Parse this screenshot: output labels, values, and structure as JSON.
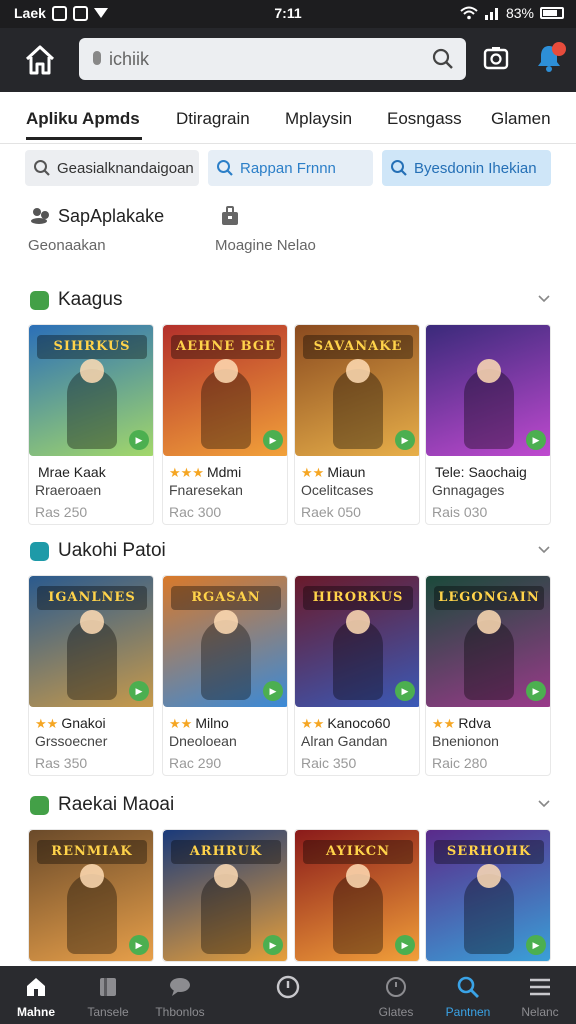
{
  "status_bar": {
    "left_text": "Laek",
    "time": "7:11",
    "battery": "83%"
  },
  "search": {
    "placeholder": "ichiik"
  },
  "tabs": [
    {
      "label": "Apliku Apmds"
    },
    {
      "label": "Dtiragrain"
    },
    {
      "label": "Mplaysin"
    },
    {
      "label": "Eosngass"
    },
    {
      "label": "Glamen"
    }
  ],
  "chips": [
    {
      "label": "Geasialknandaigoan"
    },
    {
      "label": "Rappan Frnnn"
    },
    {
      "label": "Byesdonin Ihekian"
    }
  ],
  "shortcuts": [
    {
      "title": "SapAplakake",
      "subtitle": "Geonaakan"
    },
    {
      "title": "",
      "subtitle": "Moagine Nelao"
    }
  ],
  "sections": [
    {
      "title": "Kaagus",
      "badge_color": "#43a047",
      "badge_icon": "gamepad-icon",
      "cards": [
        {
          "logo": "SIHRKUS",
          "stars": "",
          "name": "Mrae Kaak",
          "sub": "Rraeroaen",
          "price": "Ras 250",
          "colors": [
            "#2b6fb8",
            "#a3d86a"
          ]
        },
        {
          "logo": "AEHNE BGE",
          "stars": "★★★",
          "name": "Mdmi",
          "sub": "Fnaresekan",
          "price": "Rac 300",
          "colors": [
            "#b3302b",
            "#f2a23a"
          ]
        },
        {
          "logo": "SAVANAKE",
          "stars": "★★",
          "name": "Miaun",
          "sub": "Ocelitcases",
          "price": "Raek 050",
          "colors": [
            "#8a4a1f",
            "#e8b04a"
          ]
        },
        {
          "logo": "",
          "stars": "",
          "name": "Tele: Saochaig",
          "sub": "Gnnagages",
          "price": "Rais 030",
          "colors": [
            "#3a2a7a",
            "#c04ad0"
          ]
        }
      ]
    },
    {
      "title": "Uakohi Patoi",
      "badge_color": "#1e9aa8",
      "badge_icon": "star-icon",
      "cards": [
        {
          "logo": "IGANLNES",
          "stars": "★★",
          "name": "Gnakoi",
          "sub": "Grssoecner",
          "price": "Ras 350",
          "colors": [
            "#2a5a8e",
            "#c89a4a"
          ]
        },
        {
          "logo": "RGASAN",
          "stars": "★★",
          "name": "Milno",
          "sub": "Dneoloean",
          "price": "Rac 290",
          "colors": [
            "#d9792a",
            "#3a8ad8"
          ]
        },
        {
          "logo": "HIRORKUS",
          "stars": "★★",
          "name": "Kanoco60",
          "sub": "Alran Gandan",
          "price": "Raic 350",
          "colors": [
            "#6a1a2a",
            "#3a5ab8"
          ]
        },
        {
          "logo": "LEGONGAIN",
          "stars": "★★",
          "name": "Rdva",
          "sub": "Bnenionon",
          "price": "Raic 280",
          "colors": [
            "#1a4a3a",
            "#9a3a8a"
          ]
        }
      ]
    },
    {
      "title": "Raekai Maoai",
      "badge_color": "#43a047",
      "badge_icon": "gamepad-icon",
      "cards": [
        {
          "logo": "RENMIAK",
          "stars": "",
          "name": "",
          "sub": "",
          "price": "",
          "colors": [
            "#6a4a2a",
            "#e8a04a"
          ]
        },
        {
          "logo": "ARHRUK",
          "stars": "",
          "name": "",
          "sub": "",
          "price": "",
          "colors": [
            "#1a3a7a",
            "#e8a03a"
          ]
        },
        {
          "logo": "AYIKCN",
          "stars": "",
          "name": "",
          "sub": "",
          "price": "",
          "colors": [
            "#8a1a1a",
            "#f2a03a"
          ]
        },
        {
          "logo": "SERHOHK",
          "stars": "",
          "name": "",
          "sub": "",
          "price": "",
          "colors": [
            "#5a2a8a",
            "#3aa0d8"
          ]
        }
      ]
    }
  ],
  "bottom_nav": [
    {
      "label": "Mahne",
      "icon": "home-icon"
    },
    {
      "label": "Tansele",
      "icon": "library-icon"
    },
    {
      "label": "Thbonlos",
      "icon": "chat-icon"
    },
    {
      "label": "",
      "icon": "clock-icon"
    },
    {
      "label": "Glates",
      "icon": "timer-icon"
    },
    {
      "label": "Pantnen",
      "icon": "search-icon"
    },
    {
      "label": "Nelanc",
      "icon": "menu-icon"
    }
  ]
}
